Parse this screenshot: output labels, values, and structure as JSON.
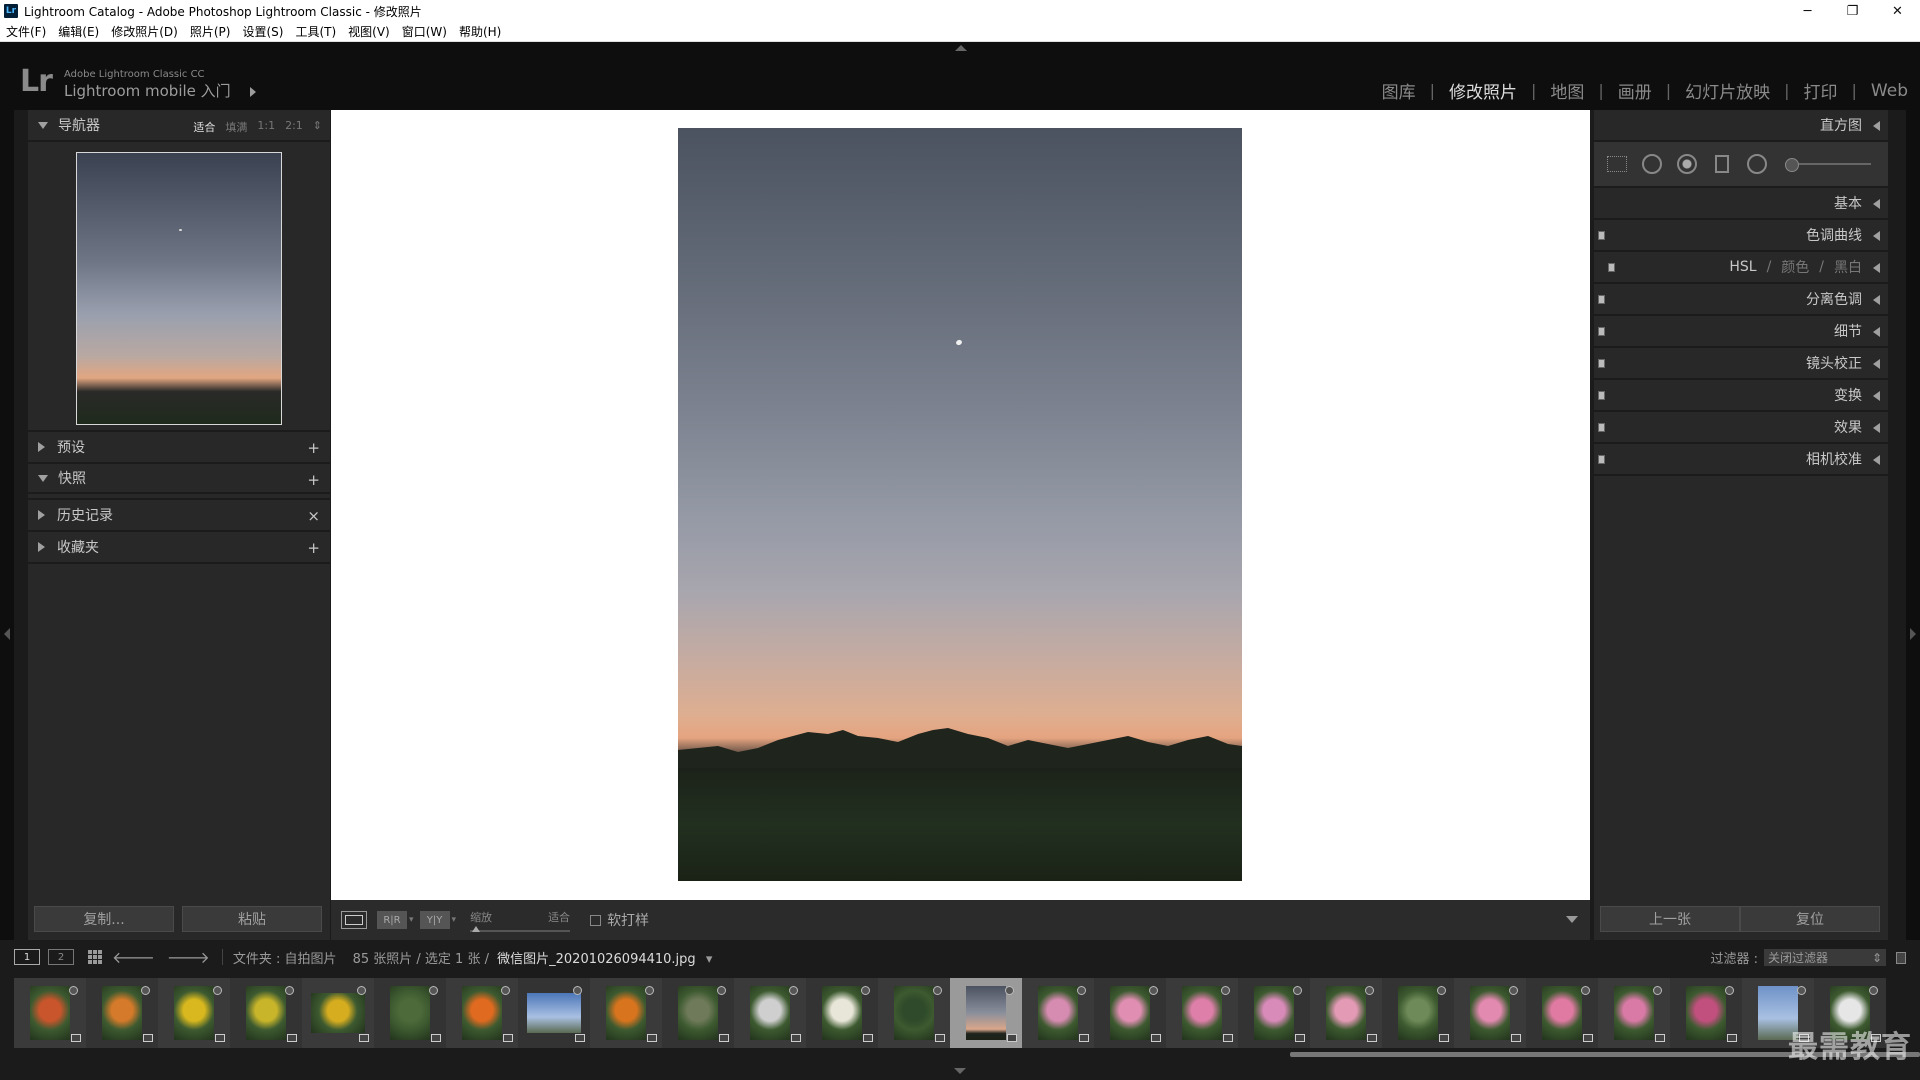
{
  "window": {
    "title": "Lightroom Catalog - Adobe Photoshop Lightroom Classic - 修改照片",
    "app_icon": "Lr",
    "controls": [
      "─",
      "❐",
      "✕"
    ]
  },
  "menu": [
    "文件(F)",
    "编辑(E)",
    "修改照片(D)",
    "照片(P)",
    "设置(S)",
    "工具(T)",
    "视图(V)",
    "窗口(W)",
    "帮助(H)"
  ],
  "identity": {
    "logo": "Lr",
    "small": "Adobe Lightroom Classic CC",
    "large": "Lightroom mobile 入门"
  },
  "modules": [
    {
      "label": "图库",
      "active": false
    },
    {
      "label": "修改照片",
      "active": true
    },
    {
      "label": "地图",
      "active": false
    },
    {
      "label": "画册",
      "active": false
    },
    {
      "label": "幻灯片放映",
      "active": false
    },
    {
      "label": "打印",
      "active": false
    },
    {
      "label": "Web",
      "active": false
    }
  ],
  "left_panel": {
    "navigator": {
      "title": "导航器",
      "zoom": [
        "适合",
        "填满",
        "1:1",
        "2:1"
      ],
      "active_zoom": "适合",
      "zoom_arrows": "⇕"
    },
    "sections": [
      {
        "title": "预设",
        "expanded": false,
        "action": "+"
      },
      {
        "title": "快照",
        "expanded": true,
        "action": "+"
      },
      {
        "title": "历史记录",
        "expanded": false,
        "action": "×"
      },
      {
        "title": "收藏夹",
        "expanded": false,
        "action": "+"
      }
    ],
    "buttons": {
      "copy": "复制...",
      "paste": "粘贴"
    }
  },
  "toolbar": {
    "ba_label_1": "R|R",
    "ba_label_2": "Y|Y",
    "caret": "▾",
    "zoom_label": "缩放",
    "zoom_value": "适合",
    "soft_proof": "软打样"
  },
  "right_panel": {
    "histogram": "直方图",
    "basic": "基本",
    "sections": [
      "色调曲线",
      "分离色调",
      "细节",
      "镜头校正",
      "变换",
      "效果",
      "相机校准"
    ],
    "hsl": {
      "hsl": "HSL",
      "sep": "/",
      "color": "颜色",
      "bw": "黑白"
    },
    "buttons": {
      "prev": "上一张",
      "reset": "复位"
    }
  },
  "filmstrip_bar": {
    "monitor_1": "1",
    "monitor_2": "2",
    "back_icon": "🡐",
    "forward_icon": "🡒",
    "path_prefix": "文件夹 : 自拍图片",
    "count": "85 张照片 / 选定 1 张 /",
    "filename": "微信图片_20201026094410.jpg",
    "filename_caret": "▾",
    "filter_label": "过滤器 :",
    "filter_value": "关闭过滤器",
    "filter_arrows": "⇕"
  },
  "filmstrip": {
    "selected_index": 13,
    "thumbs": [
      {
        "type": "orange-flower",
        "color": "#c8552c"
      },
      {
        "type": "orange-flower",
        "color": "#d47a2a"
      },
      {
        "type": "yellow-flower",
        "color": "#d8b81e"
      },
      {
        "type": "yellow-flower",
        "color": "#c9b52a"
      },
      {
        "type": "yellow-flower-wide",
        "color": "#d6ad1f"
      },
      {
        "type": "tree",
        "color": "#4d6a3a"
      },
      {
        "type": "orange-lily",
        "color": "#e06a20"
      },
      {
        "type": "sky-building",
        "color": "#4b76b8"
      },
      {
        "type": "orange-lily",
        "color": "#d8741e"
      },
      {
        "type": "plant",
        "color": "#6f7a5a"
      },
      {
        "type": "white-flower",
        "color": "#cfcfcf"
      },
      {
        "type": "white-lily",
        "color": "#e8e6d8"
      },
      {
        "type": "dark-plant",
        "color": "#2e4a2a"
      },
      {
        "type": "sunset",
        "color": "#7a7f8c"
      },
      {
        "type": "lotus",
        "color": "#d68bb0"
      },
      {
        "type": "lotus",
        "color": "#e08fb2"
      },
      {
        "type": "lotus",
        "color": "#dd7fa8"
      },
      {
        "type": "lotus",
        "color": "#d88ab8"
      },
      {
        "type": "lotus",
        "color": "#e39ab5"
      },
      {
        "type": "lotus-leaf",
        "color": "#6e8a58"
      },
      {
        "type": "lotus",
        "color": "#e38ab0"
      },
      {
        "type": "lotus",
        "color": "#e07aa2"
      },
      {
        "type": "lotus",
        "color": "#d97aa6"
      },
      {
        "type": "lotus-bud",
        "color": "#c2507e"
      },
      {
        "type": "sky",
        "color": "#6e92c8"
      },
      {
        "type": "white-flower",
        "color": "#e6e6e6"
      }
    ]
  },
  "watermark": "最需教育",
  "colors": {
    "accent": "#dcdcdc",
    "panel": "#282828",
    "background": "#1b1b1b",
    "identity": "#0e0e0e"
  }
}
